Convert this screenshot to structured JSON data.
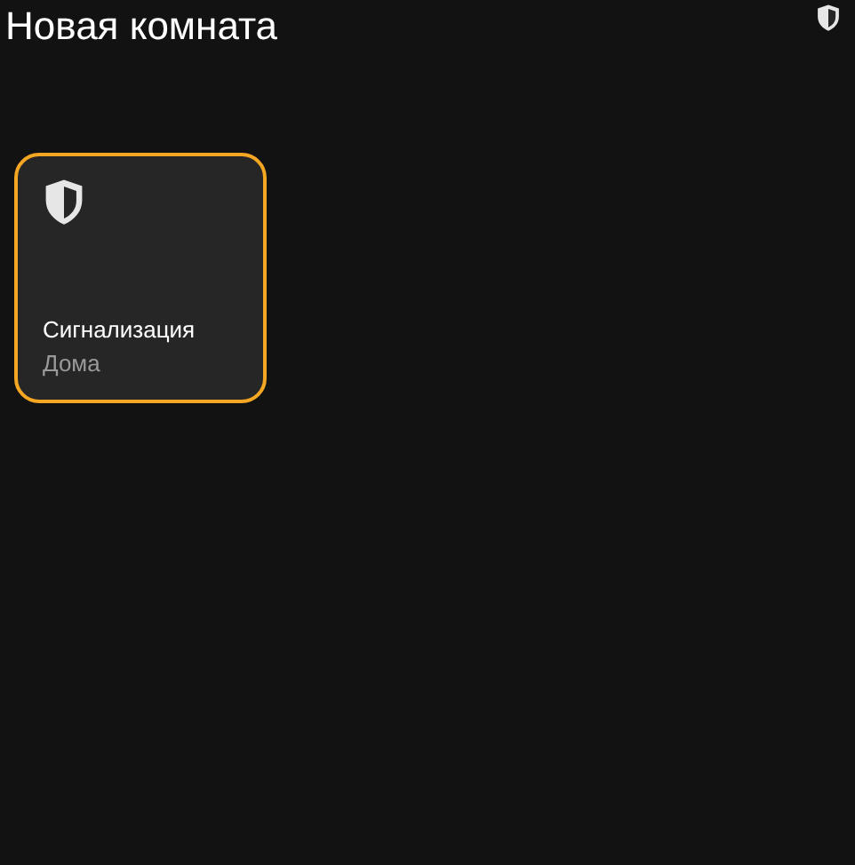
{
  "header": {
    "title": "Новая комната"
  },
  "tiles": [
    {
      "name": "Сигнализация",
      "state": "Дома",
      "active": true
    }
  ]
}
